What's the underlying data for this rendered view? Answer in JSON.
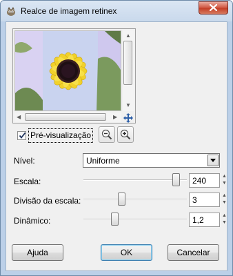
{
  "window": {
    "title": "Realce de imagem retinex",
    "app_icon": "gimp-icon",
    "close_icon": "close-icon"
  },
  "preview": {
    "image": "sunflower-photo",
    "checkbox_checked": true,
    "label": "Pré-visualização",
    "zoom_out_icon": "zoom-out-icon",
    "zoom_in_icon": "zoom-in-icon",
    "navigate_icon": "navigate-icon"
  },
  "form": {
    "level": {
      "label": "Nível:",
      "value": "Uniforme"
    },
    "scale": {
      "label": "Escala:",
      "value": "240",
      "position": 0.9
    },
    "scale_division": {
      "label": "Divisão da escala:",
      "value": "3",
      "position": 0.38
    },
    "dynamic": {
      "label": "Dinâmico:",
      "value": "1,2",
      "position": 0.3
    }
  },
  "buttons": {
    "help": "Ajuda",
    "ok": "OK",
    "cancel": "Cancelar"
  }
}
